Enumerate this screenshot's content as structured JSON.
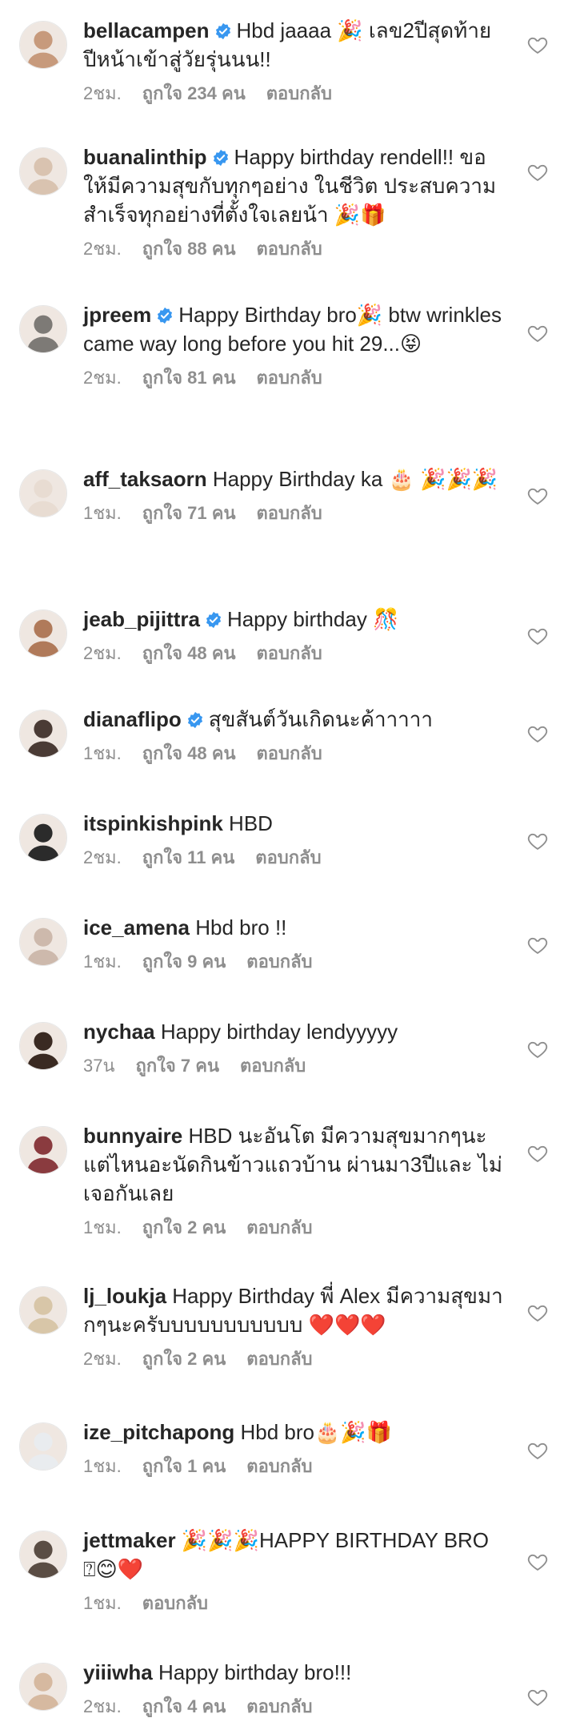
{
  "comments": [
    {
      "username": "bellacampen",
      "verified": true,
      "text": "Hbd jaaaa 🎉 เลข2ปีสุดท้าย ปีหน้าเข้าสู่วัยรุ่นนน!!",
      "time": "2ชม.",
      "likes": "ถูกใจ 234 คน",
      "reply": "ตอบกลับ",
      "avatar_color": "#c79a7c"
    },
    {
      "username": "buanalinthip",
      "verified": true,
      "text": "Happy birthday rendell!! ขอให้มีความสุขกับทุกๆอย่าง ในชีวิต ประสบความสำเร็จทุกอย่างที่ตั้งใจเลยน้า 🎉🎁",
      "time": "2ชม.",
      "likes": "ถูกใจ 88 คน",
      "reply": "ตอบกลับ",
      "avatar_color": "#d9c3b0"
    },
    {
      "username": "jpreem",
      "verified": true,
      "text": "Happy Birthday bro🎉 btw wrinkles came way long before you hit 29...😝",
      "time": "2ชม.",
      "likes": "ถูกใจ 81 คน",
      "reply": "ตอบกลับ",
      "avatar_color": "#7d7a76"
    },
    {
      "username": "aff_taksaorn",
      "verified": false,
      "text": "Happy Birthday ka 🎂 🎉🎉🎉",
      "time": "1ชม.",
      "likes": "ถูกใจ 71 คน",
      "reply": "ตอบกลับ",
      "avatar_color": "#e8dcd2"
    },
    {
      "username": "jeab_pijittra",
      "verified": true,
      "text": "Happy birthday 🎊",
      "time": "2ชม.",
      "likes": "ถูกใจ 48 คน",
      "reply": "ตอบกลับ",
      "avatar_color": "#b07a5a"
    },
    {
      "username": "dianaflipo",
      "verified": true,
      "text": "สุขสันต์วันเกิดนะค้าาาาา",
      "time": "1ชม.",
      "likes": "ถูกใจ 48 คน",
      "reply": "ตอบกลับ",
      "avatar_color": "#4a3b35"
    },
    {
      "username": "itspinkishpink",
      "verified": false,
      "text": "HBD",
      "time": "2ชม.",
      "likes": "ถูกใจ 11 คน",
      "reply": "ตอบกลับ",
      "avatar_color": "#2b2b2b"
    },
    {
      "username": "ice_amena",
      "verified": false,
      "text": "Hbd bro !!",
      "time": "1ชม.",
      "likes": "ถูกใจ 9 คน",
      "reply": "ตอบกลับ",
      "avatar_color": "#cdb9ac"
    },
    {
      "username": "nychaa",
      "verified": false,
      "text": "Happy birthday lendyyyyy",
      "time": "37น",
      "likes": "ถูกใจ 7 คน",
      "reply": "ตอบกลับ",
      "avatar_color": "#3a2a22"
    },
    {
      "username": "bunnyaire",
      "verified": false,
      "text": "HBD นะอันโต มีความสุขมากๆนะ แต่ไหนอะนัดกินข้าวแถวบ้าน ผ่านมา3ปีและ ไม่เจอกันเลย",
      "time": "1ชม.",
      "likes": "ถูกใจ 2 คน",
      "reply": "ตอบกลับ",
      "avatar_color": "#8a3b3f"
    },
    {
      "username": "lj_loukja",
      "verified": false,
      "text": "Happy Birthday พี่ Alex มีความสุขมากๆนะครับบบบบบบบบบบ ❤️❤️❤️",
      "time": "2ชม.",
      "likes": "ถูกใจ 2 คน",
      "reply": "ตอบกลับ",
      "avatar_color": "#d8c6a8"
    },
    {
      "username": "ize_pitchapong",
      "verified": false,
      "text": "Hbd bro🎂🎉🎁",
      "time": "1ชม.",
      "likes": "ถูกใจ 1 คน",
      "reply": "ตอบกลับ",
      "avatar_color": "#e9ecef"
    },
    {
      "username": "jettmaker",
      "verified": false,
      "text": "🎉🎉🎉HAPPY BIRTHDAY BRO ⍰😊❤️",
      "time": "1ชม.",
      "likes": "",
      "reply": "ตอบกลับ",
      "avatar_color": "#5a4d44"
    },
    {
      "username": "yiiiwha",
      "verified": false,
      "text": "Happy birthday bro!!!",
      "time": "2ชม.",
      "likes": "ถูกใจ 4 คน",
      "reply": "ตอบกลับ",
      "avatar_color": "#d6b9a0"
    }
  ]
}
